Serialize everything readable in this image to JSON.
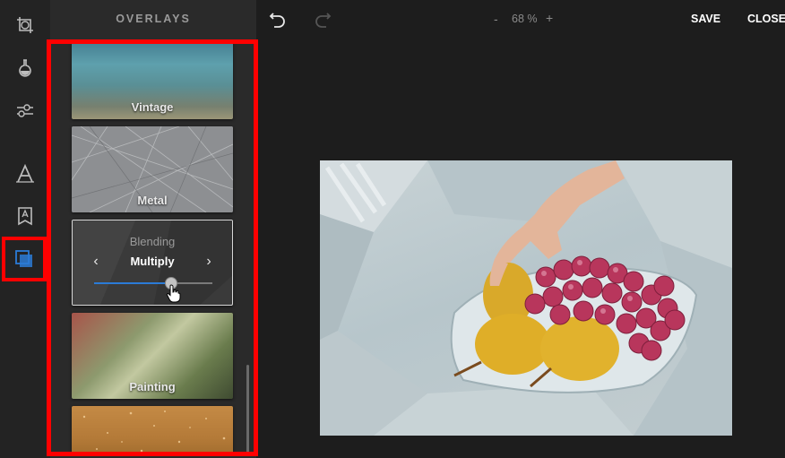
{
  "panel": {
    "title": "OVERLAYS"
  },
  "overlays": [
    {
      "label": "Vintage"
    },
    {
      "label": "Metal"
    },
    {
      "label": "Painting"
    }
  ],
  "blending": {
    "title": "Blending",
    "mode": "Multiply",
    "amount": 0.65
  },
  "topbar": {
    "zoom_out": "-",
    "zoom_level": "68 %",
    "zoom_in": "+",
    "save": "SAVE",
    "close": "CLOSE"
  },
  "icons": {
    "tools": [
      "crop-icon",
      "filter-icon",
      "adjust-icon",
      "text-icon",
      "sticker-icon",
      "overlay-icon"
    ],
    "undo": "undo-icon",
    "redo": "redo-icon"
  },
  "colors": {
    "accent": "#2b7bd6",
    "highlight": "#ff0000",
    "background": "#1d1d1d"
  }
}
